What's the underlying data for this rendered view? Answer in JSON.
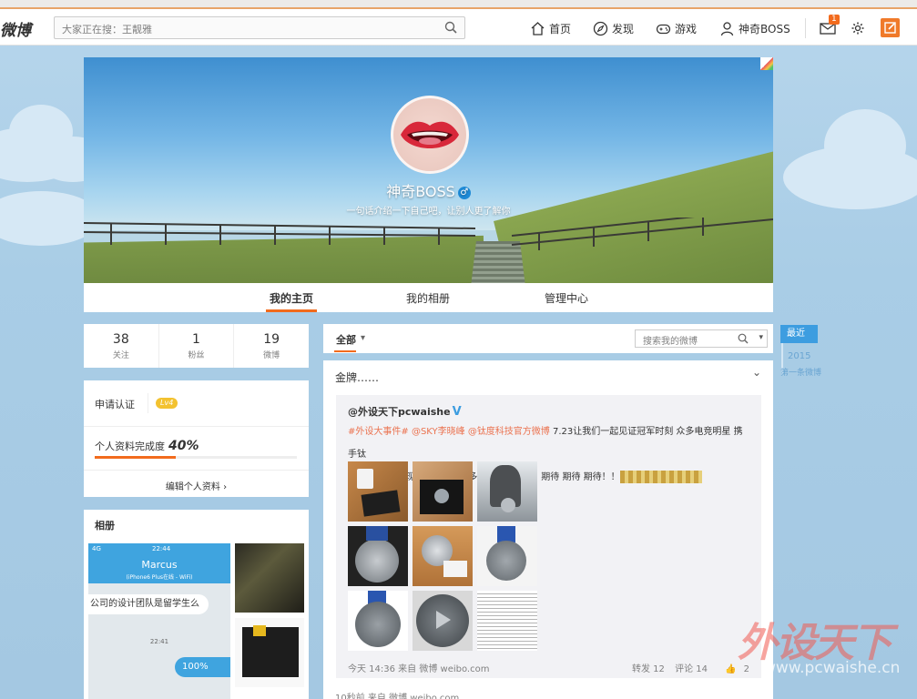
{
  "nav": {
    "logo": "微博",
    "search_placeholder": "大家正在搜：王靓雅",
    "home": "首页",
    "discover": "发现",
    "games": "游戏",
    "user": "神奇BOSS",
    "mail_badge": "1"
  },
  "profile": {
    "name": "神奇BOSS",
    "gender_icon": "male-icon",
    "intro": "一句话介绍一下自己吧，让别人更了解你"
  },
  "tabs": [
    "我的主页",
    "我的相册",
    "管理中心"
  ],
  "stats": [
    {
      "num": "38",
      "label": "关注"
    },
    {
      "num": "1",
      "label": "粉丝"
    },
    {
      "num": "19",
      "label": "微博"
    }
  ],
  "verify": {
    "apply": "申请认证",
    "level": "Lv4",
    "progress_label": "个人资料完成度",
    "progress_value": "40%",
    "progress_fraction": 0.4,
    "edit": "编辑个人资料 ›"
  },
  "album": {
    "title": "相册",
    "phone": {
      "signal": "4G",
      "clock": "22:44",
      "contact": "Marcus",
      "subtitle": "(iPhone6 Plus在线 - WiFi)",
      "bubble": "公司的设计团队是留学生么",
      "time": "22:41",
      "reply": "100%"
    }
  },
  "feed": {
    "filter": "全部",
    "filter_chevron": "chevron-down-icon",
    "search_placeholder": "搜索我的微博",
    "post": {
      "text": "金牌……",
      "repost_user": "@外设天下pcwaishe",
      "repost_text": {
        "topic": "#外设大事件#",
        "mention1": "@SKY李晓峰",
        "mention2": "@钛度科技官方微博",
        "line1_rest": " 7.23让我们一起见证冠军时刻 众多电竞明星 携手钛",
        "line2": "度产品发布会 现场会到位100多位电竞明星！！期待 期待 期待！！"
      },
      "meta": "今天 14:36 来自 微博 weibo.com",
      "forward": "转发 12",
      "comment": "评论 14",
      "like": "2",
      "next_meta": "10秒前 来自 微博 weibo.com"
    }
  },
  "timeline": {
    "recent": "最近",
    "year": "2015",
    "first": "第一条微博"
  },
  "watermark": {
    "brand": "外设天下",
    "url": "www.pcwaishe.cn"
  }
}
